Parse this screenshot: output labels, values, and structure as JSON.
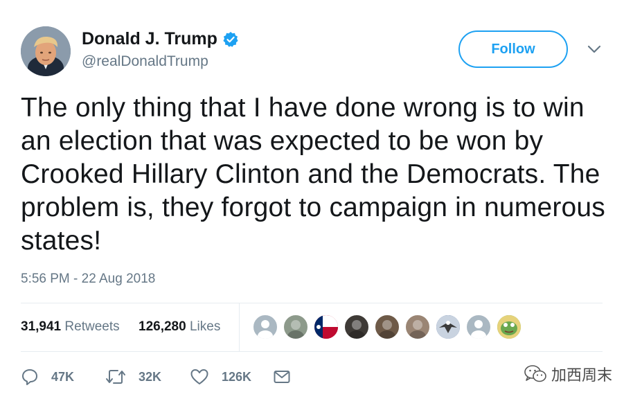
{
  "author": {
    "display_name": "Donald J. Trump",
    "handle": "@realDonaldTrump",
    "verified": true,
    "avatar_icon": "profile-photo"
  },
  "header": {
    "follow_label": "Follow",
    "menu_icon": "chevron-down-icon"
  },
  "tweet": {
    "text": "The only thing that I have done wrong is to win an election that was expected to be won by Crooked Hillary Clinton and the Democrats. The problem is, they forgot to campaign in numerous states!",
    "timestamp": "5:56 PM - 22 Aug 2018"
  },
  "stats": {
    "retweets_count": "31,941",
    "retweets_label": "Retweets",
    "likes_count": "126,280",
    "likes_label": "Likes"
  },
  "liker_avatars": [
    {
      "name": "default-profile-avatar",
      "color": "#aab8c2"
    },
    {
      "name": "landscape-avatar",
      "color": "#8d9a8b"
    },
    {
      "name": "texas-flag-avatar",
      "color": "#bf0a30"
    },
    {
      "name": "dark-photo-avatar",
      "color": "#3e3a36"
    },
    {
      "name": "portrait-avatar",
      "color": "#6e5a48"
    },
    {
      "name": "selfie-avatar",
      "color": "#9a8574"
    },
    {
      "name": "eagle-avatar",
      "color": "#3b5998"
    },
    {
      "name": "default-profile-avatar-2",
      "color": "#aab8c2"
    },
    {
      "name": "frog-avatar",
      "color": "#6aa84f"
    }
  ],
  "actions": {
    "reply_count": "47K",
    "retweet_count": "32K",
    "like_count": "126K",
    "icons": [
      "reply-icon",
      "retweet-icon",
      "like-icon",
      "message-icon"
    ]
  },
  "colors": {
    "accent": "#1da1f2",
    "text": "#14171a",
    "muted": "#657786",
    "divider": "#e6ecf0"
  },
  "watermark": {
    "text": "加西周末",
    "icon": "wechat-icon"
  }
}
